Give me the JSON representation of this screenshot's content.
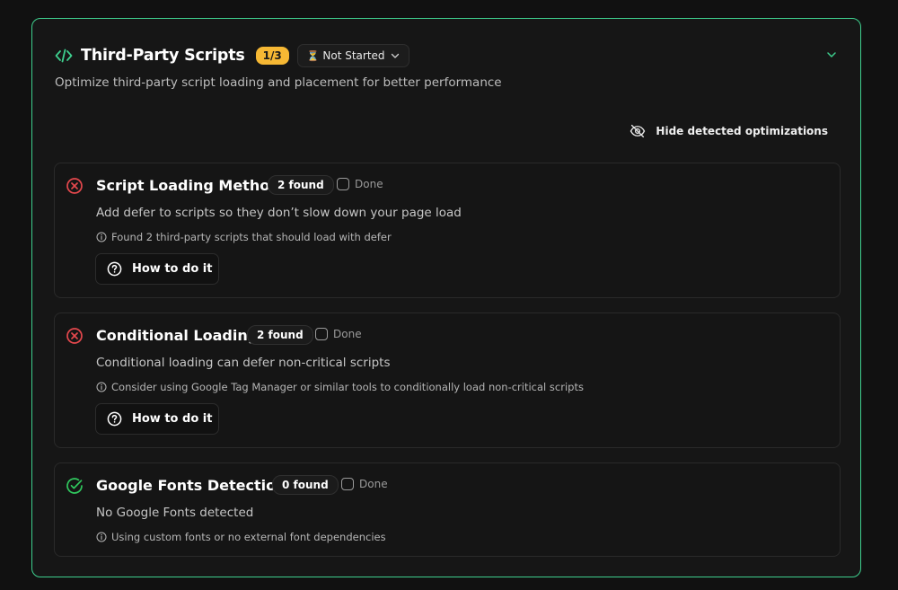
{
  "section": {
    "title": "Third-Party Scripts",
    "progress": "1/3",
    "status": {
      "label": "Not Started",
      "icon": "hourglass-icon"
    },
    "subtitle": "Optimize third-party script loading and placement for better performance",
    "hide_toggle_label": "Hide detected optimizations"
  },
  "colors": {
    "accent": "#3ecf8e",
    "badge": "#f6b834",
    "fail": "#e5484d",
    "pass": "#30c85e"
  },
  "checks": [
    {
      "title": "Script Loading Method",
      "status": "fail",
      "found": "2 found",
      "done_label": "Done",
      "description": "Add defer to scripts so they don’t slow down your page load",
      "note": "Found 2 third-party scripts that should load with defer",
      "action_label": "How to do it"
    },
    {
      "title": "Conditional Loading",
      "status": "fail",
      "found": "2 found",
      "done_label": "Done",
      "description": "Conditional loading can defer non-critical scripts",
      "note": "Consider using Google Tag Manager or similar tools to conditionally load non-critical scripts",
      "action_label": "How to do it"
    },
    {
      "title": "Google Fonts Detection",
      "status": "pass",
      "found": "0 found",
      "done_label": "Done",
      "description": "No Google Fonts detected",
      "note": "Using custom fonts or no external font dependencies"
    }
  ]
}
